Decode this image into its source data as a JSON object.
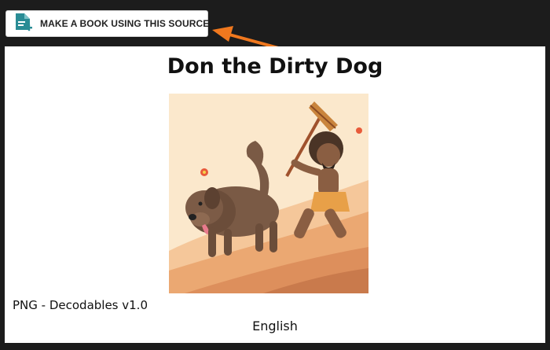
{
  "toolbar": {
    "make_book_label": "MAKE A BOOK USING THIS SOURCE",
    "make_book_icon": "add-document-icon"
  },
  "book": {
    "title": "Don the Dirty Dog",
    "cover_alt": "Illustration of a dirty brown dog running down a hill chased by a man holding a mop",
    "source": "PNG - Decodables v1.0",
    "language": "English"
  },
  "colors": {
    "background": "#1c1c1c",
    "panel": "#ffffff",
    "arrow": "#f0781e",
    "icon_teal": "#2a8c95"
  }
}
